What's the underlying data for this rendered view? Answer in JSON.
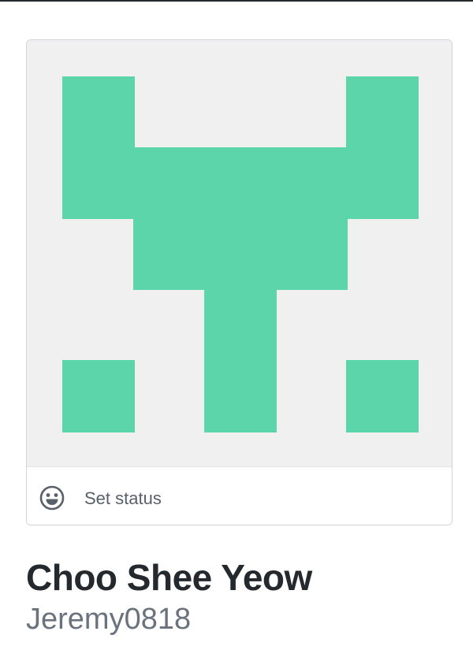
{
  "profile": {
    "full_name": "Choo Shee Yeow",
    "username": "Jeremy0818"
  },
  "status": {
    "label": "Set status",
    "icon": "smiley-icon"
  },
  "avatar": {
    "type": "identicon",
    "foreground": "#5cd5aa",
    "background": "#f0f0f0"
  },
  "colors": {
    "name_text": "#24292e",
    "username_text": "#6a737d",
    "status_text": "#586069",
    "border": "#d1d5da"
  }
}
